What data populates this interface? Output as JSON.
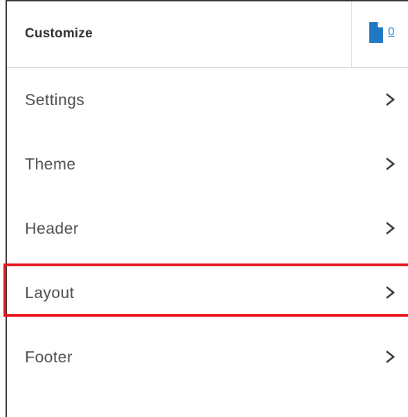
{
  "header": {
    "title": "Customize",
    "doc_count": "0",
    "doc_icon": "document-icon"
  },
  "colors": {
    "accent": "#1e78c2",
    "highlight": "#e8141b",
    "label": "#4a4a4a"
  },
  "menu": {
    "items": [
      {
        "label": "Settings",
        "icon": "chevron-right-icon"
      },
      {
        "label": "Theme",
        "icon": "chevron-right-icon"
      },
      {
        "label": "Header",
        "icon": "chevron-right-icon"
      },
      {
        "label": "Layout",
        "icon": "chevron-right-icon",
        "highlighted": true
      },
      {
        "label": "Footer",
        "icon": "chevron-right-icon"
      }
    ]
  }
}
